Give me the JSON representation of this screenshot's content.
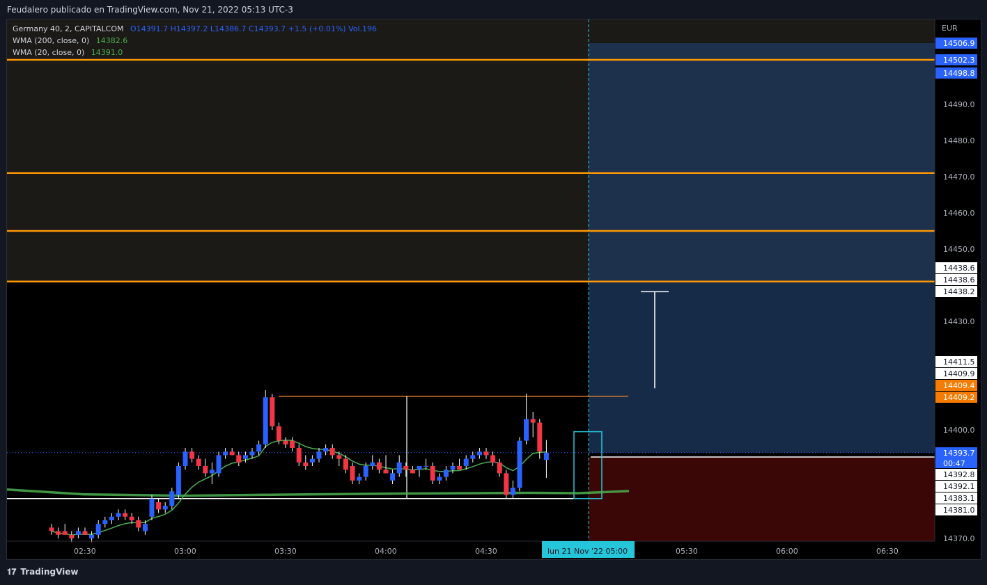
{
  "header": {
    "published": "Feudalero publicado en TradingView.com, Nov 21, 2022 05:13 UTC-3"
  },
  "legend": {
    "symbol": "Germany 40, 2, CAPITALCOM",
    "ohlc": "O14391.7  H14397.2  L14386.7  C14393.7  +1.5 (+0.01%)  Vol.196",
    "wma200_label": "WMA (200, close, 0)",
    "wma200_value": "14382.6",
    "wma20_label": "WMA (20, close, 0)",
    "wma20_value": "14391.0"
  },
  "footer": {
    "brand": "TradingView"
  },
  "colors": {
    "up": "#2962ff",
    "down": "#f23645",
    "level": "#ff9800",
    "wma20": "#4caf50",
    "wma200": "#4caf50"
  },
  "chart_data": {
    "type": "candlestick",
    "currency": "EUR",
    "y_ticks": [
      14490.0,
      14480.0,
      14470.0,
      14460.0,
      14450.0,
      14430.0,
      14400.0,
      14370.0
    ],
    "x_ticks": [
      "02:30",
      "03:00",
      "03:30",
      "04:00",
      "04:30",
      "05:30",
      "06:00",
      "06:30"
    ],
    "x_tick_times": [
      "02:30",
      "03:00",
      "03:30",
      "04:00",
      "04:30",
      "05:30",
      "06:00",
      "06:30"
    ],
    "current_time_label": "lun 21 Nov '22  05:00",
    "price_labels": [
      {
        "value": "14506.9",
        "style": "blue"
      },
      {
        "value": "14502.3",
        "style": "blue"
      },
      {
        "value": "14498.8",
        "style": "blue"
      },
      {
        "value": "14438.6",
        "style": "white"
      },
      {
        "value": "14438.6",
        "style": "white"
      },
      {
        "value": "14438.2",
        "style": "white"
      },
      {
        "value": "14411.5",
        "style": "white"
      },
      {
        "value": "14409.9",
        "style": "white"
      },
      {
        "value": "14409.4",
        "style": "orange"
      },
      {
        "value": "14409.2",
        "style": "orange"
      },
      {
        "value": "14393.7",
        "style": "blue"
      },
      {
        "value": "14392.8",
        "style": "white"
      },
      {
        "value": "14392.1",
        "style": "white"
      },
      {
        "value": "14383.1",
        "style": "white"
      },
      {
        "value": "14381.0",
        "style": "white"
      }
    ],
    "countdown": "00:47",
    "horizontal_levels": [
      14502.3,
      14471.0,
      14455.0,
      14441.0
    ],
    "candles": [
      {
        "t": "02:20",
        "o": 14373,
        "h": 14374,
        "l": 14371,
        "c": 14372
      },
      {
        "t": "02:22",
        "o": 14372,
        "h": 14373,
        "l": 14370,
        "c": 14371
      },
      {
        "t": "02:24",
        "o": 14372,
        "h": 14374,
        "l": 14371,
        "c": 14371
      },
      {
        "t": "02:26",
        "o": 14371,
        "h": 14372,
        "l": 14369,
        "c": 14370
      },
      {
        "t": "02:28",
        "o": 14371,
        "h": 14373,
        "l": 14370,
        "c": 14372
      },
      {
        "t": "02:30",
        "o": 14372,
        "h": 14373,
        "l": 14371,
        "c": 14371
      },
      {
        "t": "02:32",
        "o": 14370,
        "h": 14372,
        "l": 14369,
        "c": 14371
      },
      {
        "t": "02:34",
        "o": 14371,
        "h": 14375,
        "l": 14370,
        "c": 14374
      },
      {
        "t": "02:36",
        "o": 14374,
        "h": 14376,
        "l": 14373,
        "c": 14375
      },
      {
        "t": "02:38",
        "o": 14375,
        "h": 14377,
        "l": 14374,
        "c": 14376
      },
      {
        "t": "02:40",
        "o": 14376,
        "h": 14378,
        "l": 14375,
        "c": 14377
      },
      {
        "t": "02:42",
        "o": 14377,
        "h": 14378,
        "l": 14375,
        "c": 14376
      },
      {
        "t": "02:44",
        "o": 14376,
        "h": 14377,
        "l": 14374,
        "c": 14375
      },
      {
        "t": "02:46",
        "o": 14375,
        "h": 14376,
        "l": 14372,
        "c": 14373
      },
      {
        "t": "02:48",
        "o": 14372,
        "h": 14375,
        "l": 14371,
        "c": 14374
      },
      {
        "t": "02:50",
        "o": 14376,
        "h": 14382,
        "l": 14375,
        "c": 14381
      },
      {
        "t": "02:52",
        "o": 14380,
        "h": 14381,
        "l": 14377,
        "c": 14378
      },
      {
        "t": "02:54",
        "o": 14378,
        "h": 14380,
        "l": 14377,
        "c": 14379
      },
      {
        "t": "02:56",
        "o": 14379,
        "h": 14384,
        "l": 14378,
        "c": 14383
      },
      {
        "t": "02:58",
        "o": 14382,
        "h": 14391,
        "l": 14381,
        "c": 14390
      },
      {
        "t": "03:00",
        "o": 14390,
        "h": 14395,
        "l": 14389,
        "c": 14394
      },
      {
        "t": "03:02",
        "o": 14394,
        "h": 14395,
        "l": 14391,
        "c": 14392
      },
      {
        "t": "03:04",
        "o": 14392,
        "h": 14393,
        "l": 14389,
        "c": 14390
      },
      {
        "t": "03:06",
        "o": 14390,
        "h": 14392,
        "l": 14387,
        "c": 14388
      },
      {
        "t": "03:08",
        "o": 14388,
        "h": 14391,
        "l": 14385,
        "c": 14389
      },
      {
        "t": "03:10",
        "o": 14388,
        "h": 14394,
        "l": 14387,
        "c": 14393
      },
      {
        "t": "03:12",
        "o": 14393,
        "h": 14395,
        "l": 14392,
        "c": 14394
      },
      {
        "t": "03:14",
        "o": 14394,
        "h": 14395,
        "l": 14393,
        "c": 14393
      },
      {
        "t": "03:16",
        "o": 14393,
        "h": 14394,
        "l": 14390,
        "c": 14391
      },
      {
        "t": "03:18",
        "o": 14392,
        "h": 14394,
        "l": 14391,
        "c": 14393
      },
      {
        "t": "03:20",
        "o": 14393,
        "h": 14395,
        "l": 14392,
        "c": 14394
      },
      {
        "t": "03:22",
        "o": 14394,
        "h": 14397,
        "l": 14393,
        "c": 14396
      },
      {
        "t": "03:24",
        "o": 14396,
        "h": 14411,
        "l": 14395,
        "c": 14409
      },
      {
        "t": "03:26",
        "o": 14409,
        "h": 14410,
        "l": 14400,
        "c": 14401
      },
      {
        "t": "03:28",
        "o": 14401,
        "h": 14402,
        "l": 14396,
        "c": 14397
      },
      {
        "t": "03:30",
        "o": 14397,
        "h": 14398,
        "l": 14395,
        "c": 14396
      },
      {
        "t": "03:32",
        "o": 14397,
        "h": 14398,
        "l": 14394,
        "c": 14395
      },
      {
        "t": "03:34",
        "o": 14395,
        "h": 14396,
        "l": 14390,
        "c": 14391
      },
      {
        "t": "03:36",
        "o": 14391,
        "h": 14393,
        "l": 14389,
        "c": 14390
      },
      {
        "t": "03:38",
        "o": 14391,
        "h": 14393,
        "l": 14390,
        "c": 14392
      },
      {
        "t": "03:40",
        "o": 14392,
        "h": 14395,
        "l": 14391,
        "c": 14394
      },
      {
        "t": "03:42",
        "o": 14394,
        "h": 14396,
        "l": 14393,
        "c": 14395
      },
      {
        "t": "03:44",
        "o": 14395,
        "h": 14396,
        "l": 14392,
        "c": 14393
      },
      {
        "t": "03:46",
        "o": 14393,
        "h": 14394,
        "l": 14390,
        "c": 14392
      },
      {
        "t": "03:48",
        "o": 14392,
        "h": 14393,
        "l": 14388,
        "c": 14389
      },
      {
        "t": "03:50",
        "o": 14390,
        "h": 14391,
        "l": 14385,
        "c": 14386
      },
      {
        "t": "03:52",
        "o": 14386,
        "h": 14388,
        "l": 14385,
        "c": 14387
      },
      {
        "t": "03:54",
        "o": 14387,
        "h": 14391,
        "l": 14386,
        "c": 14390
      },
      {
        "t": "03:56",
        "o": 14390,
        "h": 14393,
        "l": 14389,
        "c": 14391
      },
      {
        "t": "03:58",
        "o": 14391,
        "h": 14392,
        "l": 14388,
        "c": 14389
      },
      {
        "t": "04:00",
        "o": 14389,
        "h": 14393,
        "l": 14388,
        "c": 14388
      },
      {
        "t": "04:02",
        "o": 14386,
        "h": 14389,
        "l": 14385,
        "c": 14388
      },
      {
        "t": "04:04",
        "o": 14388,
        "h": 14393,
        "l": 14387,
        "c": 14391
      },
      {
        "t": "04:06",
        "o": 14390,
        "h": 14391,
        "l": 14387,
        "c": 14389
      },
      {
        "t": "04:08",
        "o": 14389,
        "h": 14390,
        "l": 14388,
        "c": 14388
      },
      {
        "t": "04:10",
        "o": 14389,
        "h": 14390,
        "l": 14387,
        "c": 14390
      },
      {
        "t": "04:12",
        "o": 14390,
        "h": 14392,
        "l": 14389,
        "c": 14390
      },
      {
        "t": "04:14",
        "o": 14390,
        "h": 14391,
        "l": 14385,
        "c": 14386
      },
      {
        "t": "04:16",
        "o": 14386,
        "h": 14388,
        "l": 14385,
        "c": 14387
      },
      {
        "t": "04:18",
        "o": 14387,
        "h": 14390,
        "l": 14386,
        "c": 14389
      },
      {
        "t": "04:20",
        "o": 14389,
        "h": 14391,
        "l": 14388,
        "c": 14390
      },
      {
        "t": "04:22",
        "o": 14390,
        "h": 14392,
        "l": 14389,
        "c": 14389
      },
      {
        "t": "04:24",
        "o": 14390,
        "h": 14393,
        "l": 14389,
        "c": 14392
      },
      {
        "t": "04:26",
        "o": 14392,
        "h": 14394,
        "l": 14391,
        "c": 14393
      },
      {
        "t": "04:28",
        "o": 14393,
        "h": 14395,
        "l": 14392,
        "c": 14394
      },
      {
        "t": "04:30",
        "o": 14394,
        "h": 14395,
        "l": 14392,
        "c": 14393
      },
      {
        "t": "04:32",
        "o": 14393,
        "h": 14394,
        "l": 14390,
        "c": 14391
      },
      {
        "t": "04:34",
        "o": 14391,
        "h": 14392,
        "l": 14387,
        "c": 14388
      },
      {
        "t": "04:36",
        "o": 14388,
        "h": 14389,
        "l": 14381,
        "c": 14382
      },
      {
        "t": "04:38",
        "o": 14382,
        "h": 14386,
        "l": 14381,
        "c": 14384
      },
      {
        "t": "04:40",
        "o": 14384,
        "h": 14398,
        "l": 14383,
        "c": 14397
      },
      {
        "t": "04:42",
        "o": 14397,
        "h": 14410,
        "l": 14396,
        "c": 14403
      },
      {
        "t": "04:44",
        "o": 14403,
        "h": 14405,
        "l": 14398,
        "c": 14402
      },
      {
        "t": "04:46",
        "o": 14402,
        "h": 14403,
        "l": 14392,
        "c": 14394
      },
      {
        "t": "04:48",
        "o": 14391.7,
        "h": 14397.2,
        "l": 14386.7,
        "c": 14393.7
      }
    ]
  }
}
